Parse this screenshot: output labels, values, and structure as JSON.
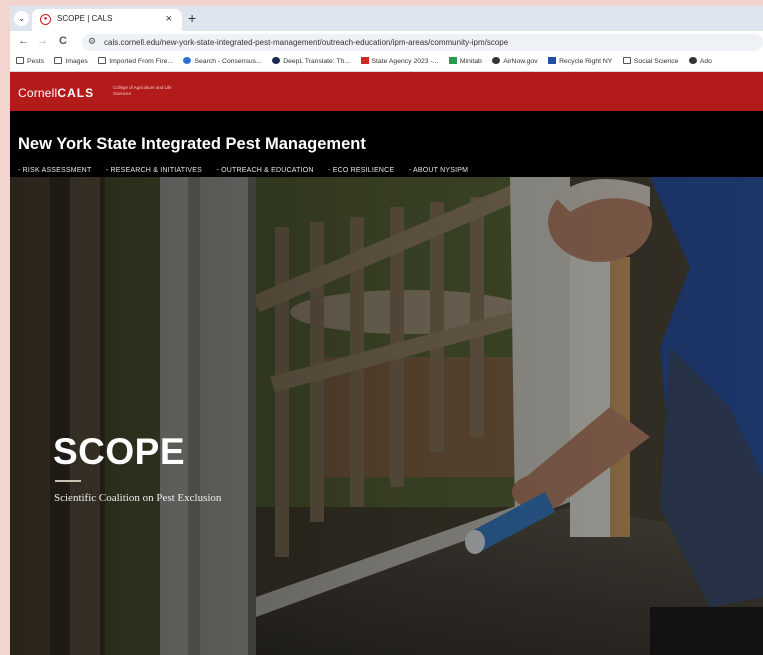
{
  "browser": {
    "tab": {
      "title": "SCOPE | CALS",
      "favicon_icon": "cornell-seal-icon",
      "close": "×"
    },
    "new_tab": "+",
    "nav": {
      "back": "←",
      "forward": "→",
      "reload": "C"
    },
    "url": "cals.cornell.edu/new-york-state-integrated-pest-management/outreach-education/ipm-areas/community-ipm/scope",
    "bookmarks": [
      {
        "label": "Pests",
        "icon": "folder-icon"
      },
      {
        "label": "Images",
        "icon": "folder-icon"
      },
      {
        "label": "Imported From Fire...",
        "icon": "folder-icon"
      },
      {
        "label": "Search - Consensus...",
        "icon": "consensus-icon"
      },
      {
        "label": "DeepL Translate: Th...",
        "icon": "deepl-icon"
      },
      {
        "label": "State Agency 2023 -...",
        "icon": "state-agency-icon"
      },
      {
        "label": "Minitab",
        "icon": "minitab-icon"
      },
      {
        "label": "AirNow.gov",
        "icon": "airnow-icon"
      },
      {
        "label": "Recycle Right NY",
        "icon": "recycle-right-icon"
      },
      {
        "label": "Social Science",
        "icon": "folder-icon"
      },
      {
        "label": "Ado",
        "icon": "adobe-icon"
      }
    ]
  },
  "site": {
    "logo_light": "Cornell",
    "logo_bold": "CALS",
    "logo_sub": "College of Agriculture and Life Sciences",
    "title": "New York State Integrated Pest Management",
    "nav": [
      {
        "label": "- RISK ASSESSMENT",
        "active": false
      },
      {
        "label": "- RESEARCH & INITIATIVES",
        "active": false
      },
      {
        "label": "- OUTREACH & EDUCATION",
        "active": true
      },
      {
        "label": "- ECO RESILIENCE",
        "active": false
      },
      {
        "label": "- ABOUT NYSIPM",
        "active": false
      }
    ]
  },
  "hero": {
    "title": "SCOPE",
    "subtitle": "Scientific Coalition on Pest Exclusion"
  },
  "colors": {
    "cornell_red": "#b31b1b",
    "header_bg": "#000000",
    "backdrop": "#f2d5ce"
  }
}
